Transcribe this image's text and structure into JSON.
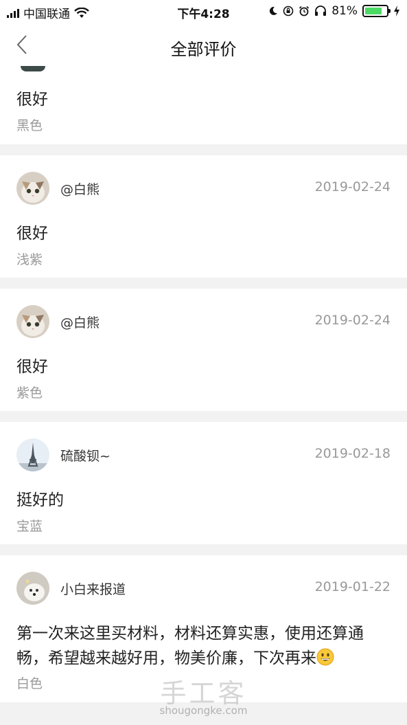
{
  "status_bar": {
    "carrier": "中国联通",
    "time": "下午4:28",
    "battery": "81%",
    "battery_level": 0.81
  },
  "nav": {
    "title": "全部评价"
  },
  "reviews": [
    {
      "content": "很好",
      "variant": "黑色"
    },
    {
      "username": "@白熊",
      "date": "2019-02-24",
      "content": "很好",
      "variant": "浅紫"
    },
    {
      "username": "@白熊",
      "date": "2019-02-24",
      "content": "很好",
      "variant": "紫色"
    },
    {
      "username": "硫酸钡~",
      "date": "2019-02-18",
      "content": "挺好的",
      "variant": "宝蓝"
    },
    {
      "username": "小白来报道",
      "date": "2019-01-22",
      "content": "第一次来这里买材料，材料还算实惠，使用还算通畅，希望越来越好用，物美价廉，下次再来",
      "variant": "白色"
    }
  ],
  "watermark": {
    "logo": "手工客",
    "url": "shougongke.com"
  },
  "colors": {
    "separator": "#f2f2f2",
    "battery_fill": "#4cd964",
    "muted_text": "#999999"
  }
}
